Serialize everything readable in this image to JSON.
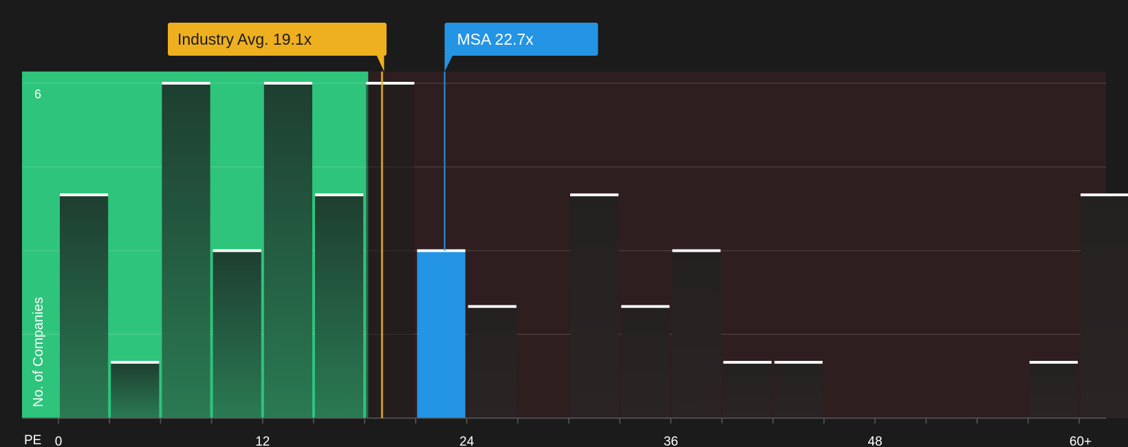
{
  "chart_data": {
    "type": "bar",
    "xlabel": "PE",
    "ylabel": "No. of Companies",
    "x_ticks": [
      "0",
      "12",
      "24",
      "36",
      "48",
      "60+"
    ],
    "y_ticks": [
      "6"
    ],
    "x_range": [
      0,
      60
    ],
    "y_range": [
      0,
      6
    ],
    "bin_width": 3,
    "bins": [
      {
        "start": 0,
        "count": 4
      },
      {
        "start": 3,
        "count": 1
      },
      {
        "start": 6,
        "count": 6
      },
      {
        "start": 9,
        "count": 3
      },
      {
        "start": 12,
        "count": 6
      },
      {
        "start": 15,
        "count": 4
      },
      {
        "start": 18,
        "count": 6
      },
      {
        "start": 21,
        "count": 3
      },
      {
        "start": 24,
        "count": 2
      },
      {
        "start": 27,
        "count": 0
      },
      {
        "start": 30,
        "count": 4
      },
      {
        "start": 33,
        "count": 2
      },
      {
        "start": 36,
        "count": 3
      },
      {
        "start": 39,
        "count": 1
      },
      {
        "start": 42,
        "count": 1
      },
      {
        "start": 45,
        "count": 0
      },
      {
        "start": 48,
        "count": 0
      },
      {
        "start": 51,
        "count": 0
      },
      {
        "start": 54,
        "count": 0
      },
      {
        "start": 57,
        "count": 1
      },
      {
        "start": 60,
        "count": 4
      }
    ],
    "annotations": [
      {
        "label": "Industry Avg. 19.1x",
        "value": 19.1,
        "color": "#efb01f"
      },
      {
        "label": "MSA 22.7x",
        "value": 22.7,
        "color": "#2494e4"
      }
    ],
    "grid": true,
    "colors": {
      "background": "#1b1b1b",
      "below_region": "#2ec47b",
      "above_region": "#2e1e1f",
      "bar_below": "#23563d",
      "bar_above": "#272221",
      "highlight": "#2494e4",
      "industry": "#efb01f",
      "cap": "#ffffff"
    }
  }
}
